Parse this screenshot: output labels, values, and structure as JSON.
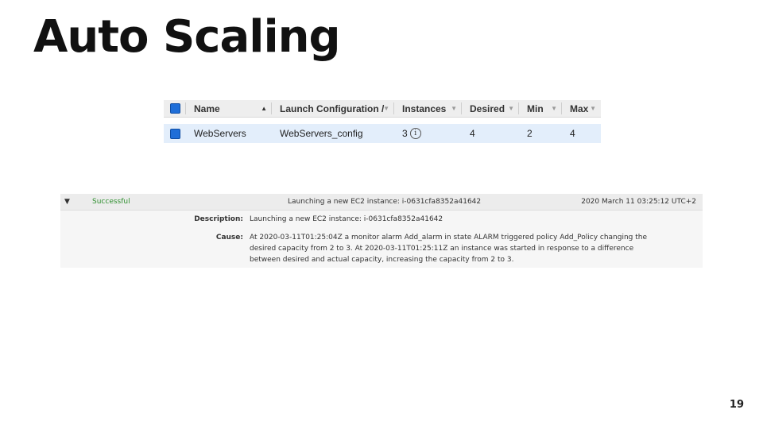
{
  "slide": {
    "title": "Auto Scaling",
    "page_number": "19"
  },
  "asg_table": {
    "headers": {
      "name": "Name",
      "launch_configuration": "Launch Configuration /",
      "instances": "Instances",
      "desired": "Desired",
      "min": "Min",
      "max": "Max"
    },
    "rows": [
      {
        "name": "WebServers",
        "launch_configuration": "WebServers_config",
        "instances": "3",
        "desired": "4",
        "min": "2",
        "max": "4"
      }
    ],
    "icons": {
      "sort": "sort-ascending-icon",
      "info": "info-icon"
    },
    "colors": {
      "selected_row": "#e3eefb",
      "checkbox": "#1f6ed8"
    }
  },
  "activity": {
    "status": "Successful",
    "description": "Launching a new EC2 instance: i-0631cfa8352a41642",
    "timestamp": "2020 March 11 03:25:12 UTC+2",
    "details": {
      "description_label": "Description:",
      "description_value": "Launching a new EC2 instance: i-0631cfa8352a41642",
      "cause_label": "Cause:",
      "cause_value": "At 2020-03-11T01:25:04Z a monitor alarm Add_alarm in state ALARM triggered policy Add_Policy changing the desired capacity from 2 to 3. At 2020-03-11T01:25:11Z an instance was started in response to a difference between desired and actual capacity, increasing the capacity from 2 to 3."
    },
    "colors": {
      "status": "#2f8f2f"
    }
  }
}
